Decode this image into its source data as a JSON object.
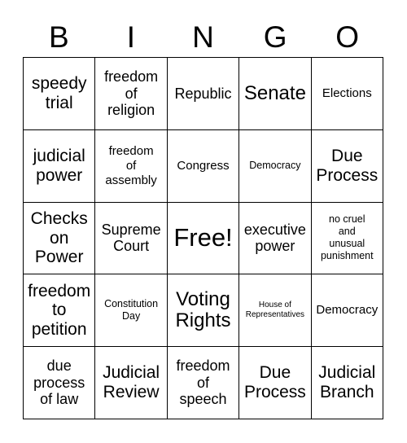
{
  "card": {
    "title": "BINGO",
    "header_letters": [
      "B",
      "I",
      "N",
      "G",
      "O"
    ],
    "free_space_label": "Free!",
    "colors": {
      "background": "#ffffff",
      "border": "#000000",
      "text": "#000000"
    },
    "grid": {
      "rows": 5,
      "columns": 5,
      "cells": [
        {
          "text": "speedy\ntrial",
          "size": "lg"
        },
        {
          "text": "freedom\nof\nreligion",
          "size": "md"
        },
        {
          "text": "Republic",
          "size": "md"
        },
        {
          "text": "Senate",
          "size": "xl"
        },
        {
          "text": "Elections",
          "size": "sm"
        },
        {
          "text": "judicial\npower",
          "size": "lg"
        },
        {
          "text": "freedom\nof\nassembly",
          "size": "sm"
        },
        {
          "text": "Congress",
          "size": "sm"
        },
        {
          "text": "Democracy",
          "size": "xs"
        },
        {
          "text": "Due\nProcess",
          "size": "lg"
        },
        {
          "text": "Checks\non\nPower",
          "size": "lg"
        },
        {
          "text": "Supreme\nCourt",
          "size": "md"
        },
        {
          "text": "Free!",
          "size": "xxl"
        },
        {
          "text": "executive\npower",
          "size": "md"
        },
        {
          "text": "no cruel\nand\nunusual\npunishment",
          "size": "xs"
        },
        {
          "text": "freedom\nto\npetition",
          "size": "lg"
        },
        {
          "text": "Constitution\nDay",
          "size": "xs"
        },
        {
          "text": "Voting\nRights",
          "size": "xl"
        },
        {
          "text": "House of\nRepresentatives",
          "size": "xxs"
        },
        {
          "text": "Democracy",
          "size": "sm"
        },
        {
          "text": "due\nprocess\nof law",
          "size": "md"
        },
        {
          "text": "Judicial\nReview",
          "size": "lg"
        },
        {
          "text": "freedom\nof\nspeech",
          "size": "md"
        },
        {
          "text": "Due\nProcess",
          "size": "lg"
        },
        {
          "text": "Judicial\nBranch",
          "size": "lg"
        }
      ]
    }
  }
}
